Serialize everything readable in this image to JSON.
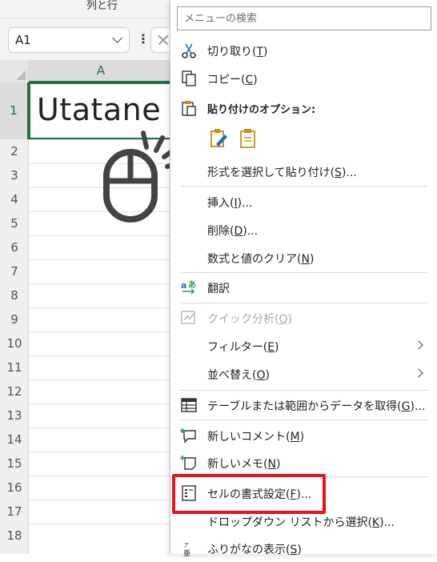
{
  "ribbon": {
    "group_label": "列と行"
  },
  "formula_bar": {
    "name_box_value": "A1",
    "fx_separator": "⋮"
  },
  "grid": {
    "column_header": "A",
    "row_numbers": [
      "1",
      "2",
      "3",
      "4",
      "5",
      "6",
      "7",
      "8",
      "9",
      "10",
      "11",
      "12",
      "13",
      "14",
      "15",
      "16",
      "17",
      "18"
    ],
    "cell_a1_value": "Utatane"
  },
  "context_menu": {
    "search_placeholder": "メニューの検索",
    "items": {
      "cut": {
        "text": "切り取り(",
        "key": "T",
        "suffix": ")"
      },
      "copy": {
        "text": "コピー(",
        "key": "C",
        "suffix": ")"
      },
      "paste_options_header": "貼り付けのオプション:",
      "paste_special": {
        "text": "形式を選択して貼り付け(",
        "key": "S",
        "suffix": ")..."
      },
      "insert": {
        "text": "挿入(",
        "key": "I",
        "suffix": ")..."
      },
      "delete": {
        "text": "削除(",
        "key": "D",
        "suffix": ")..."
      },
      "clear_contents": {
        "text": "数式と値のクリア(",
        "key": "N",
        "suffix": ")"
      },
      "translate": {
        "text": "翻訳"
      },
      "quick_analysis": {
        "text": "クイック分析(",
        "key": "Q",
        "suffix": ")"
      },
      "filter": {
        "text": "フィルター(",
        "key": "E",
        "suffix": ")"
      },
      "sort": {
        "text": "並べ替え(",
        "key": "O",
        "suffix": ")"
      },
      "get_data": {
        "text": "テーブルまたは範囲からデータを取得(",
        "key": "G",
        "suffix": ")..."
      },
      "new_comment": {
        "text": "新しいコメント(",
        "key": "M",
        "suffix": ")"
      },
      "new_note": {
        "text": "新しいメモ(",
        "key": "N",
        "suffix": ")"
      },
      "format_cells": {
        "text": "セルの書式設定(",
        "key": "F",
        "suffix": ")..."
      },
      "pick_from_list": {
        "text": "ドロップダウン リストから選択(",
        "key": "K",
        "suffix": ")..."
      },
      "phonetic": {
        "text": "ふりがなの表示(",
        "key": "S",
        "suffix": ")"
      }
    }
  },
  "colors": {
    "accent_green": "#1e7145",
    "highlight_red": "#e8141a"
  }
}
